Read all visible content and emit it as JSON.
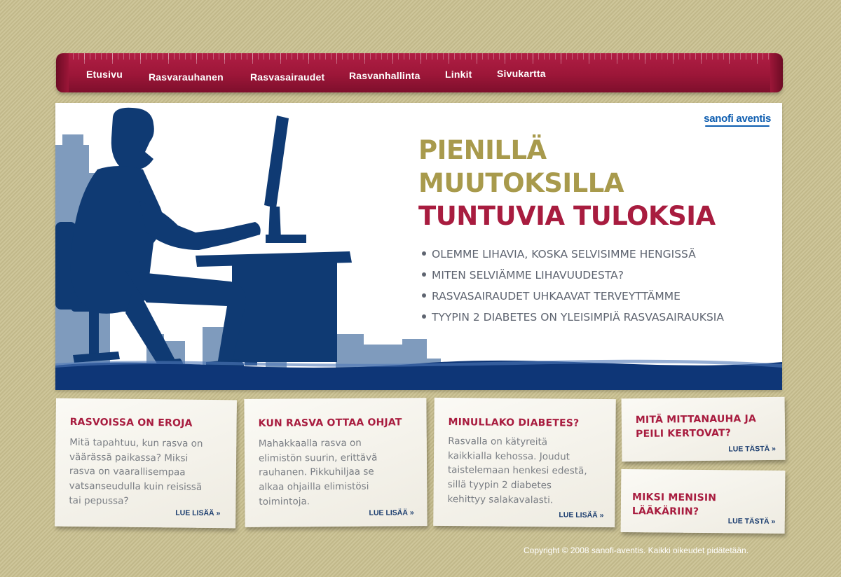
{
  "nav": {
    "items": [
      "Etusivu",
      "Rasvarauhanen",
      "Rasvasairaudet",
      "Rasvanhallinta",
      "Linkit",
      "Sivukartta"
    ]
  },
  "hero": {
    "logo": "sanofi aventis",
    "headline": [
      "PIENILLÄ",
      "MUUTOKSILLA",
      "TUNTUVIA TULOKSIA"
    ],
    "bullets": [
      "OLEMME LIHAVIA, KOSKA SELVISIMME HENGISSÄ",
      "MITEN SELVIÄMME LIHAVUUDESTA?",
      "RASVASAIRAUDET UHKAAVAT TERVEYTTÄMME",
      "TYYPIN 2 DIABETES ON YLEISIMPIÄ RASVASAIRAUKSIA"
    ]
  },
  "cards": [
    {
      "title": "RASVOISSA ON EROJA",
      "body": [
        "Mitä tapahtuu, kun rasva on",
        "väärässä paikassa? Miksi",
        "rasva on vaarallisempaa",
        "vatsanseudulla kuin reisissä",
        "tai pepussa?"
      ],
      "link": "LUE LISÄÄ »"
    },
    {
      "title": "KUN RASVA OTTAA OHJAT",
      "body": [
        "Mahakkaalla rasva on",
        "elimistön suurin, erittävä",
        "rauhanen. Pikkuhiljaa se",
        "alkaa ohjailla elimistösi",
        "toimintoja."
      ],
      "link": "LUE LISÄÄ »"
    },
    {
      "title": "MINULLAKO DIABETES?",
      "body": [
        "Rasvalla on kätyreitä",
        "kaikkialla kehossa. Joudut",
        "taistelemaan henkesi edestä,",
        "sillä tyypin 2 diabetes",
        "kehittyy salakavalasti."
      ],
      "link": "LUE LISÄÄ »"
    },
    {
      "title": [
        "MITÄ MITTANAUHA JA",
        "PEILI KERTOVAT?"
      ],
      "link": "LUE TÄSTÄ »"
    },
    {
      "title": "MIKSI MENISIN LÄÄKÄRIIN?",
      "link": "LUE TÄSTÄ »"
    }
  ],
  "footer": {
    "copyright": "Copyright © 2008 sanofi-aventis. Kaikki oikeudet pidätetään."
  },
  "colors": {
    "nav": "#9c1638",
    "accent_red": "#a81c3f",
    "accent_olive": "#a89a4c",
    "silhouette": "#0f3a73",
    "skyline": "#7f9bbd"
  }
}
